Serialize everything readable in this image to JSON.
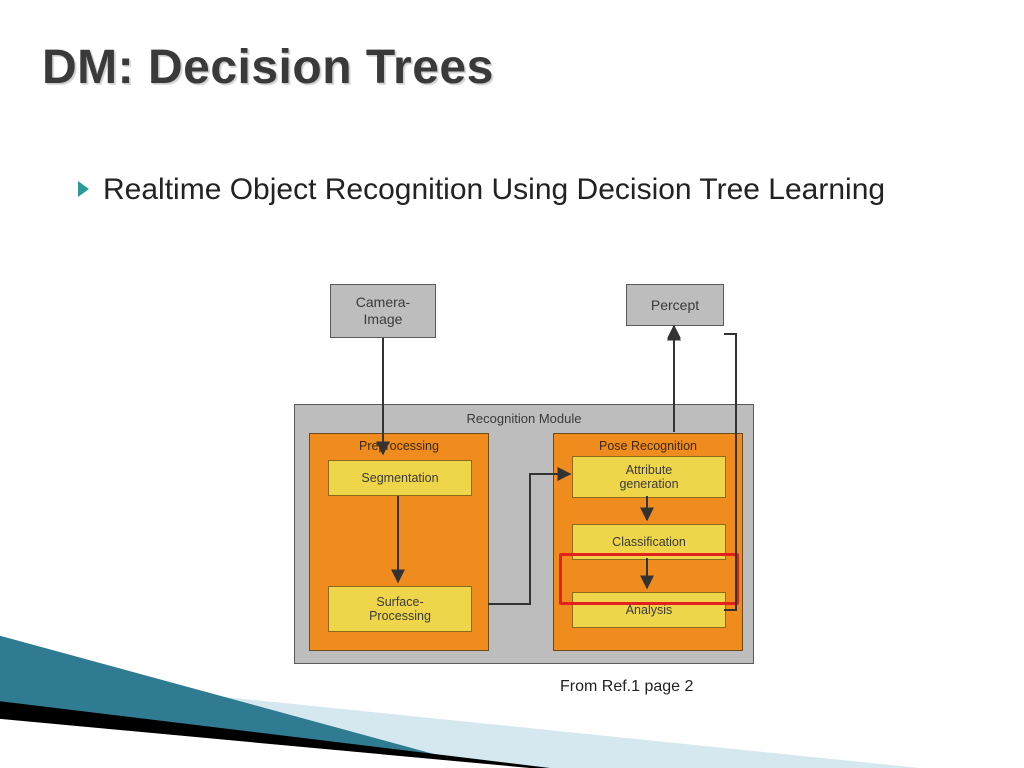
{
  "title": "DM: Decision Trees",
  "bullet": "Realtime Object Recognition Using Decision Tree Learning",
  "caption": "From Ref.1 page 2",
  "diagram": {
    "camera_image": "Camera-\nImage",
    "percept": "Percept",
    "module_label": "Recognition Module",
    "preprocess": {
      "title": "Preprocessing",
      "segmentation": "Segmentation",
      "surface": "Surface-\nProcessing"
    },
    "pose": {
      "title": "Pose Recognition",
      "attr": "Attribute\ngeneration",
      "classif": "Classification",
      "analysis": "Analysis"
    }
  }
}
